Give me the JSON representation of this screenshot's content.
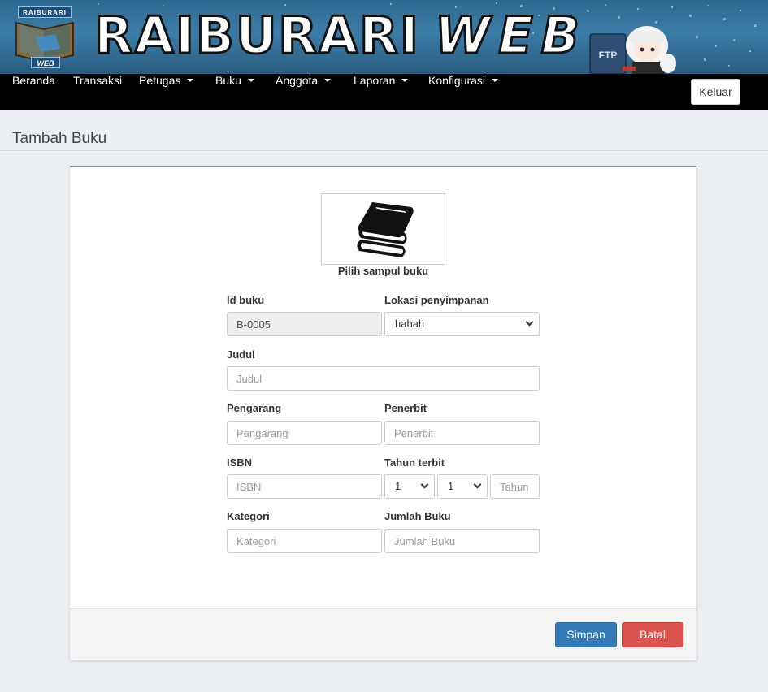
{
  "banner": {
    "title_main": "RAIBURARI",
    "title_web": "WEB",
    "logo_top": "RAIBURARI",
    "logo_bottom": "WEB",
    "mascot_book_label": "FTP"
  },
  "nav": {
    "items": [
      {
        "label": "Beranda",
        "dropdown": false
      },
      {
        "label": "Transaksi",
        "dropdown": false
      },
      {
        "label": "Petugas",
        "dropdown": true
      },
      {
        "label": "Buku",
        "dropdown": true
      },
      {
        "label": "Anggota",
        "dropdown": true
      },
      {
        "label": "Laporan",
        "dropdown": true
      },
      {
        "label": "Konfigurasi",
        "dropdown": true
      }
    ],
    "logout_label": "Keluar"
  },
  "page": {
    "title": "Tambah Buku"
  },
  "form": {
    "cover_caption": "Pilih sampul buku",
    "id_label": "Id buku",
    "id_value": "B-0005",
    "location_label": "Lokasi penyimpanan",
    "location_value": "hahah",
    "title_label": "Judul",
    "title_placeholder": "Judul",
    "author_label": "Pengarang",
    "author_placeholder": "Pengarang",
    "publisher_label": "Penerbit",
    "publisher_placeholder": "Penerbit",
    "isbn_label": "ISBN",
    "isbn_placeholder": "ISBN",
    "year_label": "Tahun terbit",
    "day_value": "1",
    "month_value": "1",
    "year_placeholder": "Tahun",
    "category_label": "Kategori",
    "category_placeholder": "Kategori",
    "qty_label": "Jumlah Buku",
    "qty_placeholder": "Jumlah Buku"
  },
  "actions": {
    "save_label": "Simpan",
    "cancel_label": "Batal"
  },
  "colors": {
    "primary": "#337ab7",
    "danger": "#d9534f",
    "navbar": "#000000",
    "banner": "#2e6a92"
  }
}
